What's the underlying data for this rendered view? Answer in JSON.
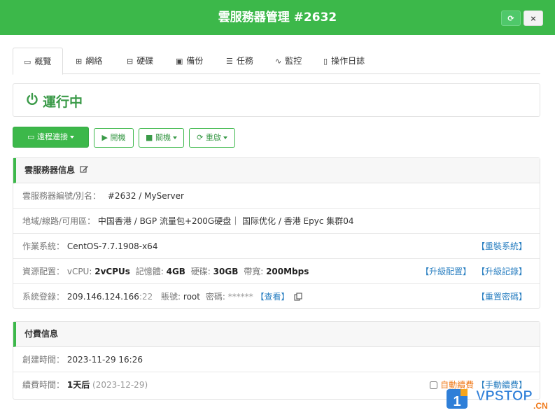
{
  "header": {
    "title": "雲服務器管理 #2632",
    "refresh_icon": "⟳",
    "close_icon": "×"
  },
  "tabs": [
    {
      "label": "概覽",
      "icon": "monitor-icon",
      "glyph": "▭"
    },
    {
      "label": "網絡",
      "icon": "sitemap-icon",
      "glyph": "⊞"
    },
    {
      "label": "硬碟",
      "icon": "hdd-icon",
      "glyph": "⊟"
    },
    {
      "label": "備份",
      "icon": "floppy-icon",
      "glyph": "▣"
    },
    {
      "label": "任務",
      "icon": "tasks-icon",
      "glyph": "☰"
    },
    {
      "label": "監控",
      "icon": "pulse-icon",
      "glyph": "∿"
    },
    {
      "label": "操作日誌",
      "icon": "file-icon",
      "glyph": "▯"
    }
  ],
  "status": {
    "text": "運行中",
    "color": "#3a9a48"
  },
  "actions": {
    "remote": "遠程連接",
    "boot": "開機",
    "shutdown": "關機",
    "restart": "重啟",
    "remote_glyph": "▭",
    "boot_glyph": "▶",
    "shutdown_glyph": "■",
    "restart_glyph": "⟳"
  },
  "server_info": {
    "title": "雲服務器信息",
    "id_label": "雲服務器編號/別名：",
    "id_value": "#2632 / MyServer",
    "region_label": "地域/線路/可用區：",
    "region_value": "中国香港 / BGP 流量包+200G硬盘｜ 国际优化 / 香港 Epyc 集群04",
    "os_label": "作業系統：",
    "os_value": "CentOS-7.7.1908-x64",
    "reinstall": "【重裝系統】",
    "res_label": "資源配置：",
    "vcpu_label": "vCPU:",
    "vcpu_value": "2vCPUs",
    "mem_label": "記憶體:",
    "mem_value": "4GB",
    "disk_label": "硬碟:",
    "disk_value": "30GB",
    "bw_label": "帶寬:",
    "bw_value": "200Mbps",
    "upgrade": "【升級配置】",
    "upgrade_log": "【升級記錄】",
    "login_label": "系統登錄：",
    "ip": "209.146.124.166",
    "port": ":22",
    "account_label": "賬號:",
    "account_value": "root",
    "pwd_label": "密碼:",
    "pwd_value": "******",
    "view": "【查看】",
    "reset_pwd": "【重置密碼】"
  },
  "billing": {
    "title": "付費信息",
    "created_label": "創建時間：",
    "created_value": "2023-11-29 16:26",
    "renew_label": "續費時間：",
    "renew_value": "1天后",
    "renew_date": "(2023-12-29)",
    "auto_renew": "自動續費",
    "manual_renew": "【手動續費】"
  },
  "watermark": {
    "text": "VPSTOP",
    "suffix": ".CN",
    "badge": "1"
  }
}
